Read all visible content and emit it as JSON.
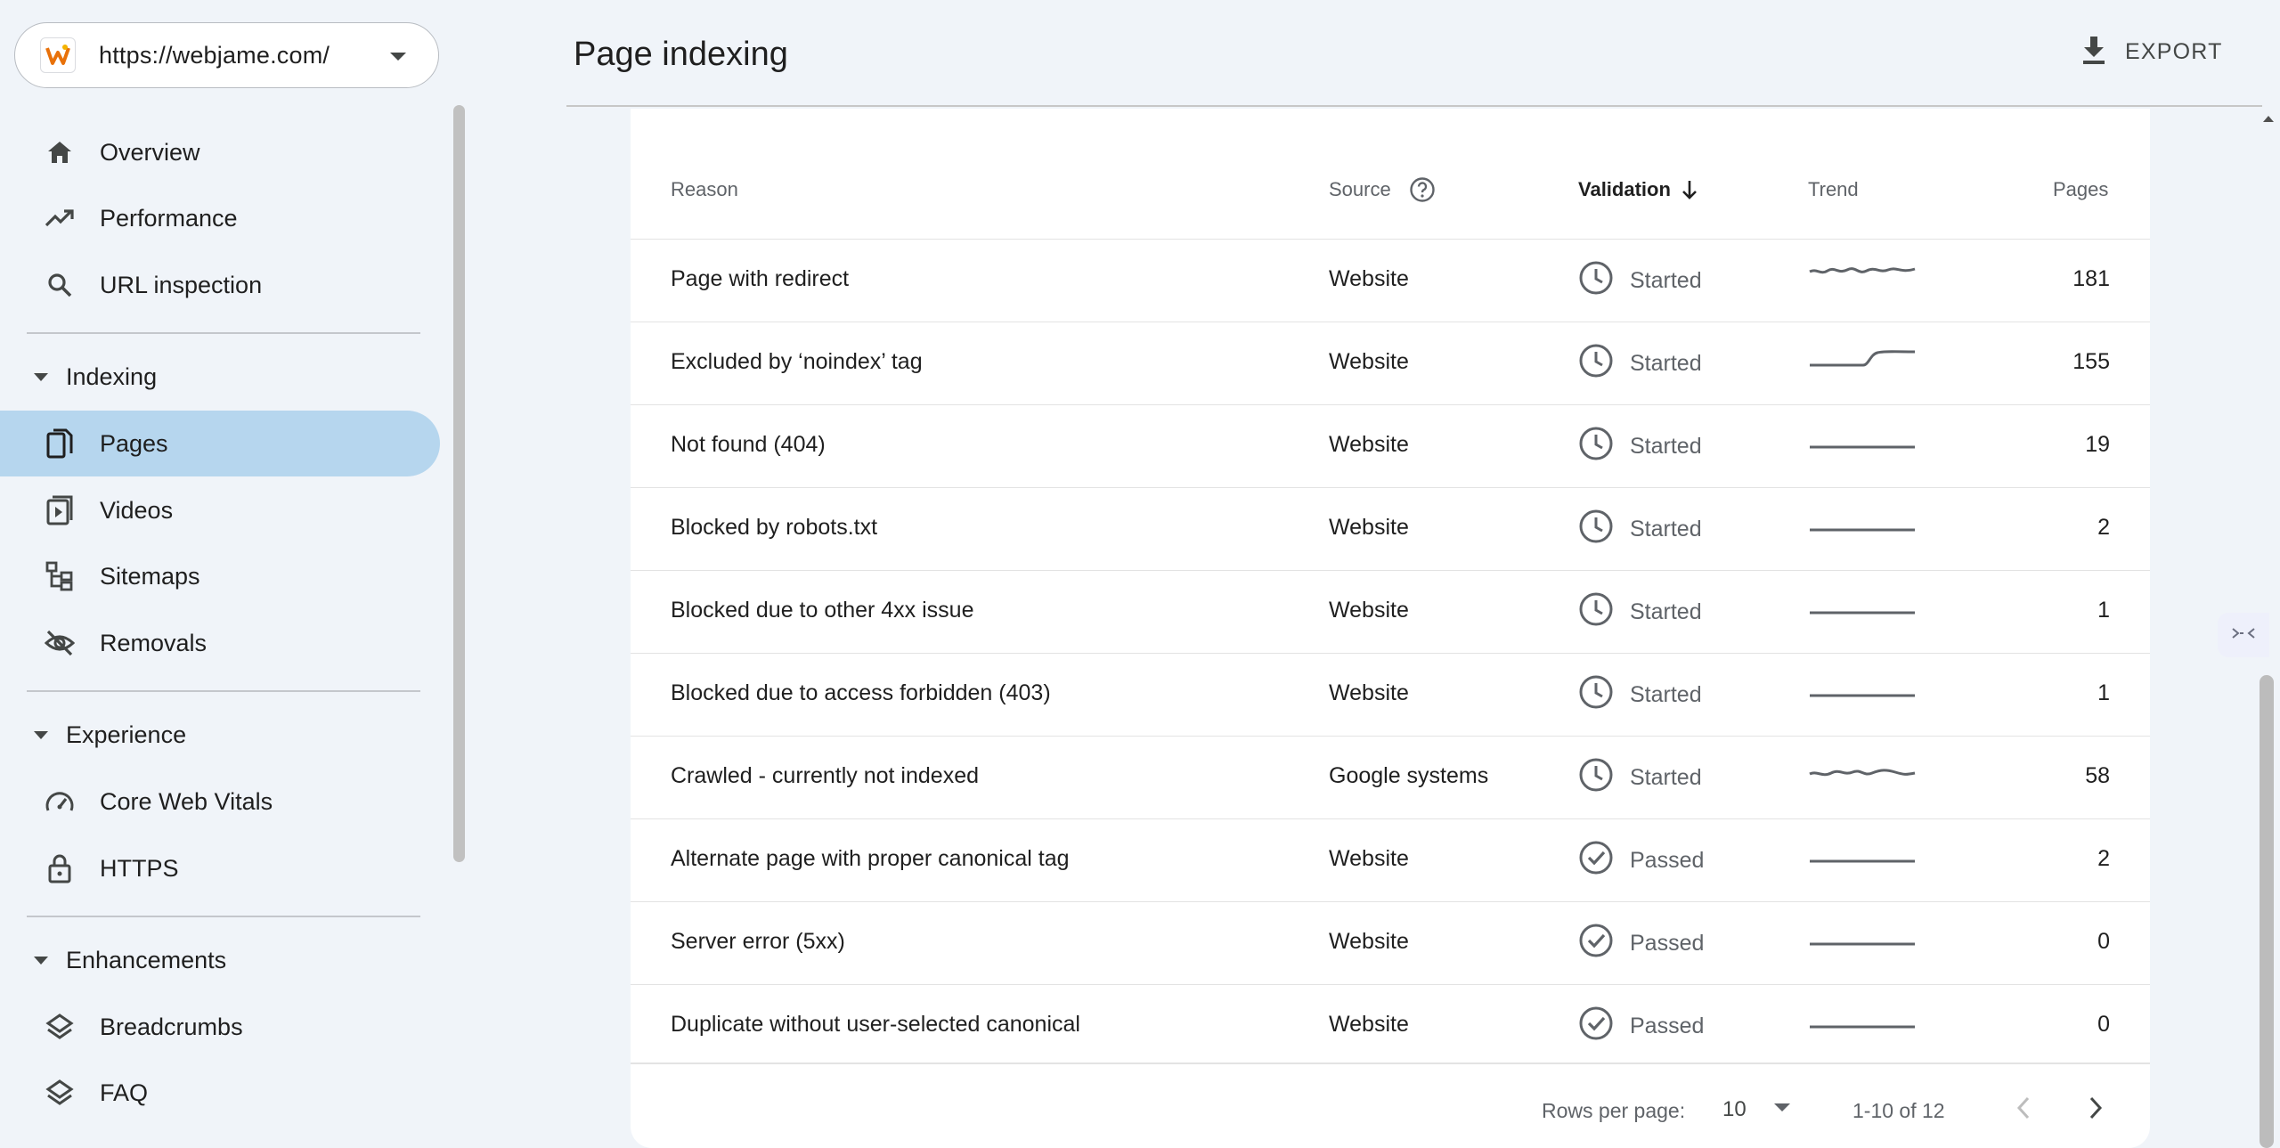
{
  "property": {
    "url": "https://webjame.com/"
  },
  "sidebar": {
    "items": [
      {
        "label": "Overview",
        "icon": "home-icon"
      },
      {
        "label": "Performance",
        "icon": "trending-up-icon"
      },
      {
        "label": "URL inspection",
        "icon": "search-icon"
      }
    ],
    "indexing": {
      "title": "Indexing",
      "items": [
        {
          "label": "Pages",
          "icon": "pages-icon",
          "active": true
        },
        {
          "label": "Videos",
          "icon": "video-pages-icon"
        },
        {
          "label": "Sitemaps",
          "icon": "sitemap-icon"
        },
        {
          "label": "Removals",
          "icon": "eye-off-icon"
        }
      ]
    },
    "experience": {
      "title": "Experience",
      "items": [
        {
          "label": "Core Web Vitals",
          "icon": "speed-gauge-icon"
        },
        {
          "label": "HTTPS",
          "icon": "lock-icon"
        }
      ]
    },
    "enhancements": {
      "title": "Enhancements",
      "items": [
        {
          "label": "Breadcrumbs",
          "icon": "layers-icon"
        },
        {
          "label": "FAQ",
          "icon": "layers-icon"
        }
      ]
    }
  },
  "header": {
    "title": "Page indexing",
    "export_label": "EXPORT"
  },
  "table": {
    "columns": {
      "reason": "Reason",
      "source": "Source",
      "validation": "Validation",
      "trend": "Trend",
      "pages": "Pages"
    },
    "rows": [
      {
        "reason": "Page with redirect",
        "source": "Website",
        "validation": "Started",
        "pages": "181"
      },
      {
        "reason": "Excluded by ‘noindex’ tag",
        "source": "Website",
        "validation": "Started",
        "pages": "155"
      },
      {
        "reason": "Not found (404)",
        "source": "Website",
        "validation": "Started",
        "pages": "19"
      },
      {
        "reason": "Blocked by robots.txt",
        "source": "Website",
        "validation": "Started",
        "pages": "2"
      },
      {
        "reason": "Blocked due to other 4xx issue",
        "source": "Website",
        "validation": "Started",
        "pages": "1"
      },
      {
        "reason": "Blocked due to access forbidden (403)",
        "source": "Website",
        "validation": "Started",
        "pages": "1"
      },
      {
        "reason": "Crawled - currently not indexed",
        "source": "Google systems",
        "validation": "Started",
        "pages": "58"
      },
      {
        "reason": "Alternate page with proper canonical tag",
        "source": "Website",
        "validation": "Passed",
        "pages": "2"
      },
      {
        "reason": "Server error (5xx)",
        "source": "Website",
        "validation": "Passed",
        "pages": "0"
      },
      {
        "reason": "Duplicate without user-selected canonical",
        "source": "Website",
        "validation": "Passed",
        "pages": "0"
      }
    ]
  },
  "pagination": {
    "rows_per_page_label": "Rows per page:",
    "rows_per_page_value": "10",
    "range": "1-10 of 12"
  },
  "colors": {
    "active_nav": "#b6d6ee",
    "background": "#f0f4f9",
    "accent_logo": "#e8710a"
  }
}
